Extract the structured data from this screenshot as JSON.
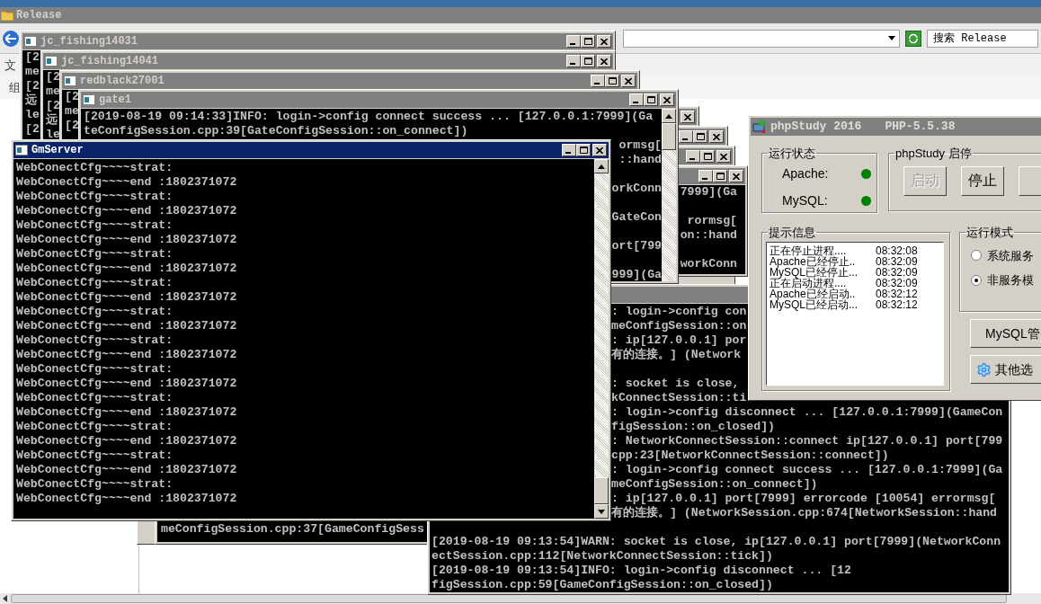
{
  "explorer": {
    "title": "Release",
    "menu_fragments": [
      "文",
      "组"
    ],
    "search": {
      "placeholder": "搜索 Release"
    }
  },
  "consoles": [
    {
      "title": "jc_fishing14031",
      "active": false,
      "lines": [
        "[2",
        "me",
        "[2",
        "远",
        "le",
        "[2"
      ]
    },
    {
      "title": "jc_fishing14041",
      "active": false,
      "lines": [
        "[2",
        "me",
        "[2",
        "远",
        "le"
      ]
    },
    {
      "title": "redblack27001",
      "active": false,
      "lines": [
        "[2",
        "me",
        "[2"
      ]
    },
    {
      "active": false,
      "lines": [
        "7999](Ga",
        "rormsg[",
        "on::hand",
        "workConn"
      ]
    },
    {
      "title": "gate1",
      "active": false,
      "lines": [
        "[2019-08-19 09:14:33]INFO: login->config connect success ... [127.0.0.1:7999](Ga",
        "teConfigSession.cpp:39[GateConfigSession::on_connect])",
        "ormsg[",
        "::hand",
        "orkConn",
        "GateCon",
        "ort[799",
        "999](Ga"
      ]
    },
    {
      "lines": [
        "meConfigSession.cpp:37[GameConfigSess"
      ]
    },
    {
      "active": false,
      "lines": [
        ": login->config con",
        "meConfigSession::on",
        ": ip[127.0.0.1] por",
        "有的连接。] (Network",
        ": socket is close,",
        "kConnectSession::ti",
        ": login->config disconnect ... [127.0.0.1:7999](GameCon",
        "figSession::on_closed])",
        ": NetworkConnectSession::connect ip[127.0.0.1] port[799",
        "cpp:23[NetworkConnectSession::connect])",
        ": login->config connect success ... [127.0.0.1:7999](Ga",
        "meConfigSession::on_connect])",
        ": ip[127.0.0.1] port[7999] errorcode [10054] errormsg[",
        "有的连接。] (NetworkSession.cpp:674[NetworkSession::hand",
        "[2019-08-19 09:13:54]WARN: socket is close, ip[127.0.0.1] port[7999](NetworkConn",
        "ectSession.cpp:112[NetworkConnectSession::tick])",
        "[2019-08-19 09:13:54]INFO: login->config disconnect ... [12",
        "figSession.cpp:59[GameConfigSession::on_closed])"
      ]
    },
    {
      "title": "GmServer",
      "active": true,
      "lines": [
        "WebConectCfg~~~~strat:",
        "WebConectCfg~~~~end :1802371072",
        "WebConectCfg~~~~strat:",
        "WebConectCfg~~~~end :1802371072",
        "WebConectCfg~~~~strat:",
        "WebConectCfg~~~~end :1802371072",
        "WebConectCfg~~~~strat:",
        "WebConectCfg~~~~end :1802371072",
        "WebConectCfg~~~~strat:",
        "WebConectCfg~~~~end :1802371072",
        "WebConectCfg~~~~strat:",
        "WebConectCfg~~~~end :1802371072",
        "WebConectCfg~~~~strat:",
        "WebConectCfg~~~~end :1802371072",
        "WebConectCfg~~~~strat:",
        "WebConectCfg~~~~end :1802371072",
        "WebConectCfg~~~~strat:",
        "WebConectCfg~~~~end :1802371072",
        "WebConectCfg~~~~strat:",
        "WebConectCfg~~~~end :1802371072",
        "WebConectCfg~~~~strat:",
        "WebConectCfg~~~~end :1802371072",
        "WebConectCfg~~~~strat:",
        "WebConectCfg~~~~end :1802371072"
      ]
    }
  ],
  "php_study": {
    "title": "phpStudy 2016",
    "version": "PHP-5.5.38",
    "status": {
      "label": "运行状态",
      "items": [
        {
          "name": "Apache:",
          "running": true
        },
        {
          "name": "MySQL:",
          "running": true
        }
      ]
    },
    "control": {
      "label": "phpStudy 启停",
      "buttons": [
        {
          "label": "启动",
          "disabled": true
        },
        {
          "label": "停止",
          "disabled": false
        }
      ]
    },
    "log": {
      "label": "提示信息",
      "rows": [
        {
          "text": "正在停止进程....",
          "time": "08:32:08"
        },
        {
          "text": "Apache已经停止..",
          "time": "08:32:09"
        },
        {
          "text": "MySQL已经停止...",
          "time": "08:32:09"
        },
        {
          "text": "正在启动进程....",
          "time": "08:32:09"
        },
        {
          "text": "Apache已经启动..",
          "time": "08:32:12"
        },
        {
          "text": "MySQL已经启动...",
          "time": "08:32:12"
        }
      ]
    },
    "mode": {
      "label": "运行模式",
      "options": [
        {
          "label": "系统服务",
          "selected": false
        },
        {
          "label": "非服务模",
          "selected": true
        }
      ]
    },
    "buttons": [
      {
        "label": "MySQL管",
        "kind": "plain"
      },
      {
        "label": "其他选",
        "kind": "gear"
      }
    ]
  }
}
